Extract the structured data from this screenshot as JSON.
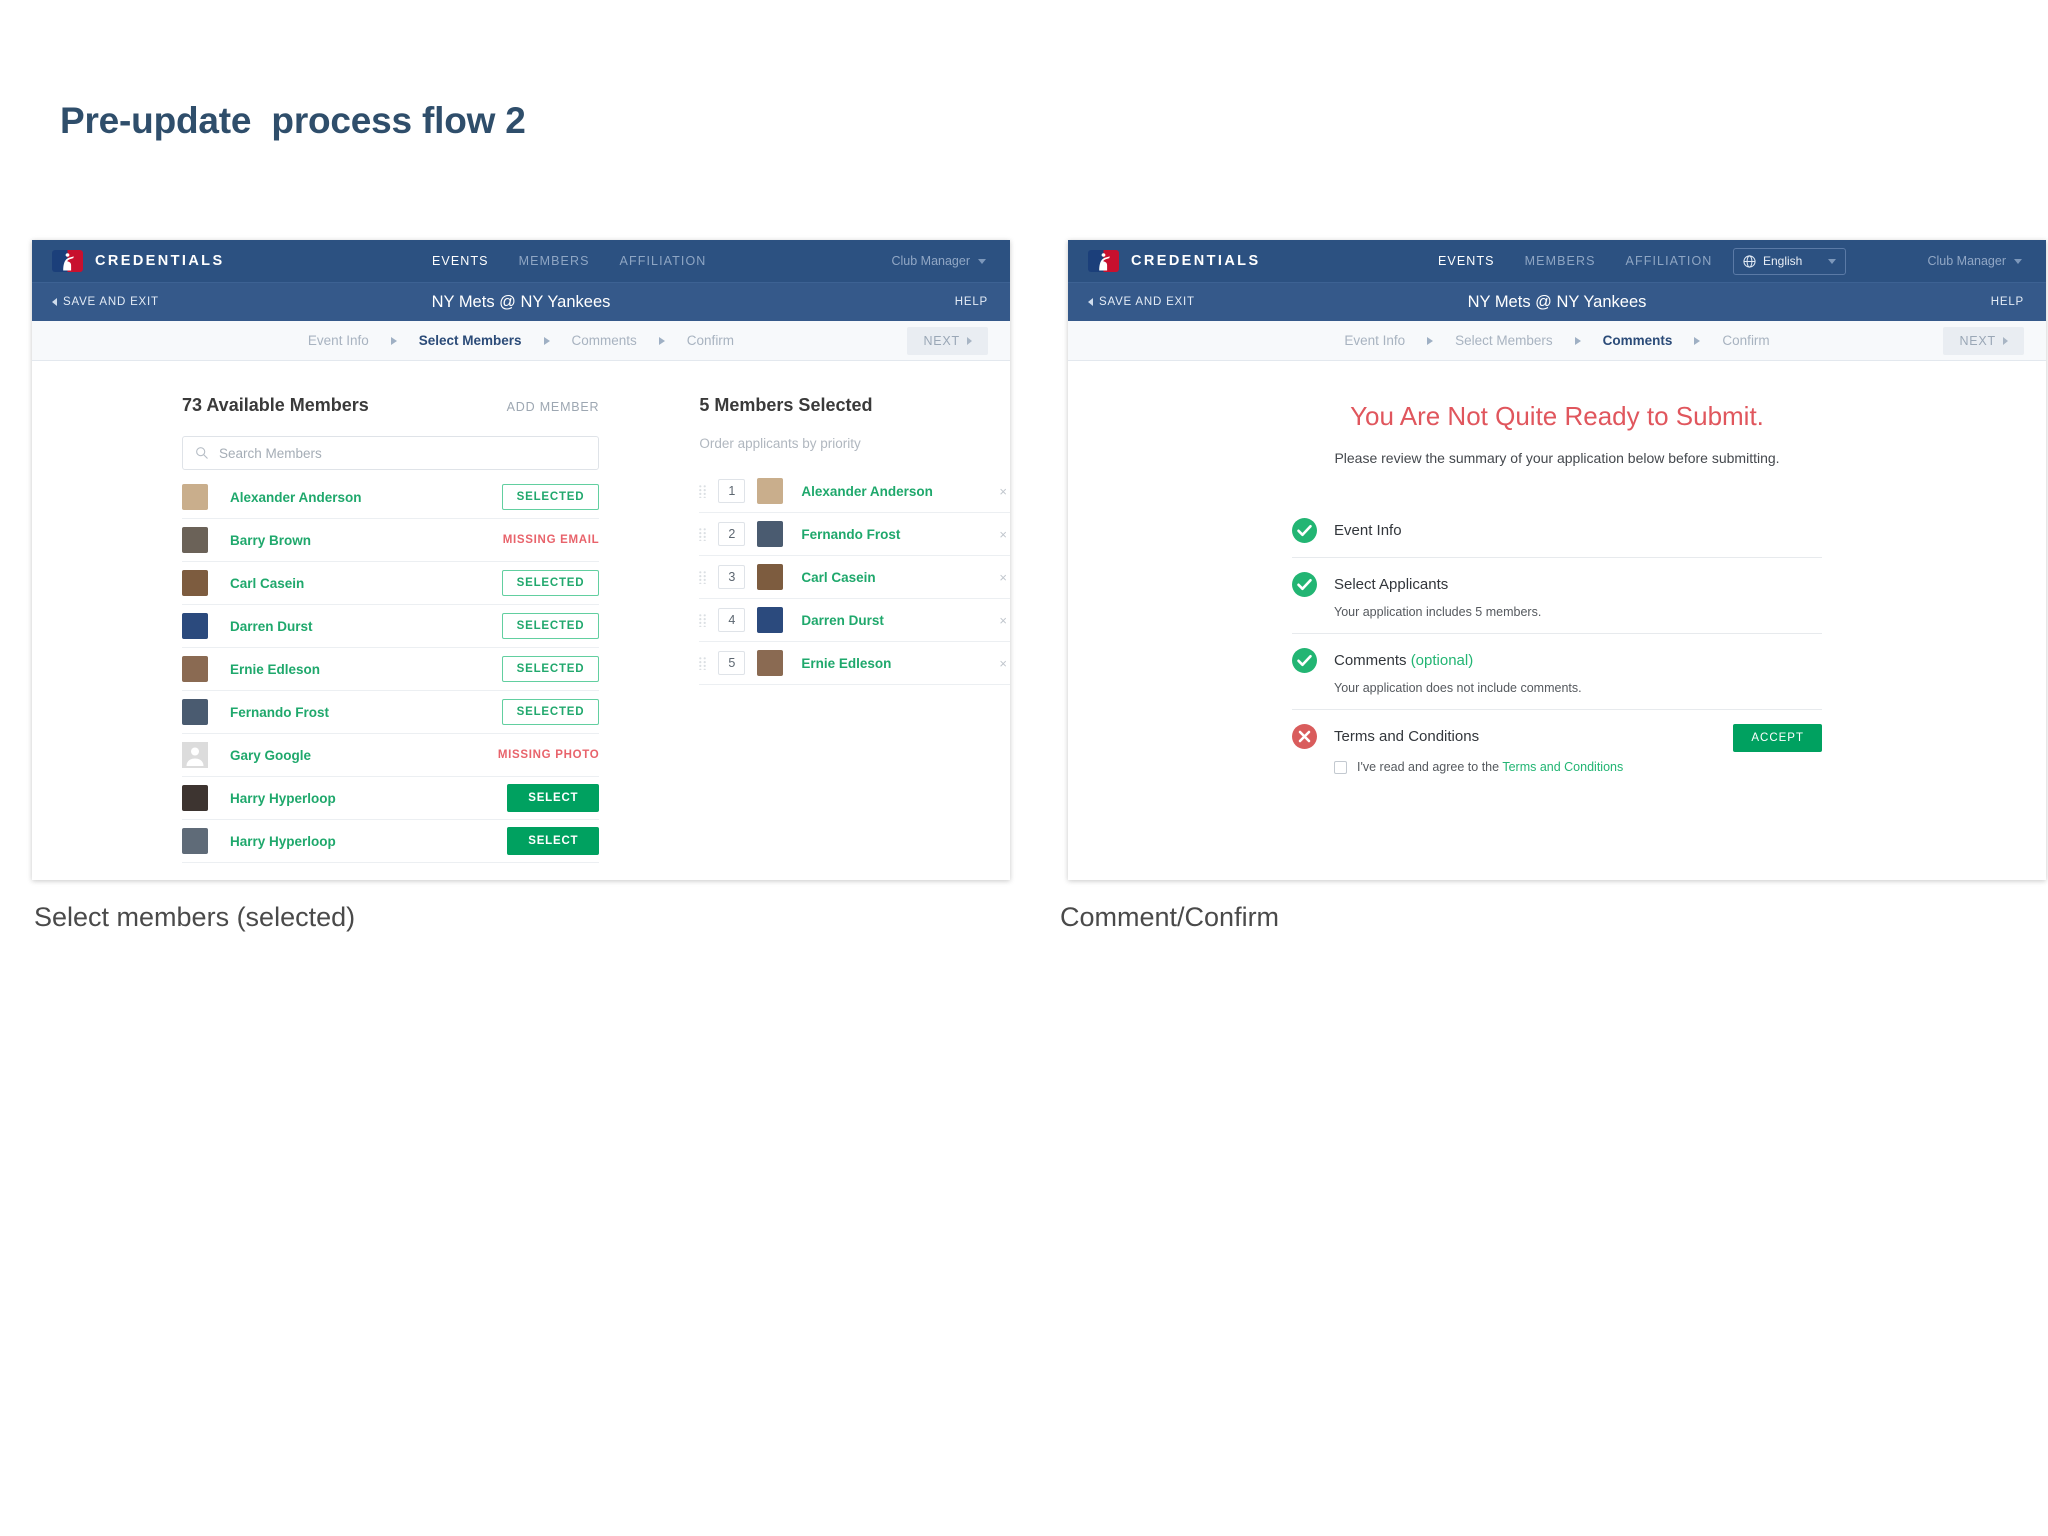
{
  "page": {
    "title": "Pre-update  process flow 2"
  },
  "brand": {
    "name": "CREDENTIALS",
    "logo_icon": "mlb-logo-icon"
  },
  "panels": {
    "left": {
      "caption": "Select members (selected)",
      "topnav": [
        {
          "label": "EVENTS",
          "active": true
        },
        {
          "label": "MEMBERS",
          "active": false
        },
        {
          "label": "AFFILIATION",
          "active": false
        }
      ],
      "user_menu": {
        "label": "Club Manager",
        "icon": "chevron-down-icon"
      },
      "subheader": {
        "save_and_exit": "SAVE AND EXIT",
        "event_title": "NY Mets @ NY Yankees",
        "help": "HELP"
      },
      "steps": [
        {
          "label": "Event Info",
          "active": false
        },
        {
          "label": "Select Members",
          "active": true
        },
        {
          "label": "Comments",
          "active": false
        },
        {
          "label": "Confirm",
          "active": false
        }
      ],
      "next_button": "NEXT",
      "available": {
        "heading": "73 Available Members",
        "add_member": "ADD MEMBER",
        "search_placeholder": "Search Members",
        "search_value": "",
        "rows": [
          {
            "name": "Alexander Anderson",
            "action": "SELECTED",
            "action_type": "selected",
            "avatar": "#c9ae8c"
          },
          {
            "name": "Barry Brown",
            "action": "MISSING EMAIL",
            "action_type": "status",
            "avatar": "#6b6258"
          },
          {
            "name": "Carl Casein",
            "action": "SELECTED",
            "action_type": "selected",
            "avatar": "#7d5c3f"
          },
          {
            "name": "Darren Durst",
            "action": "SELECTED",
            "action_type": "selected",
            "avatar": "#2b4a7d"
          },
          {
            "name": "Ernie Edleson",
            "action": "SELECTED",
            "action_type": "selected",
            "avatar": "#8a6a52"
          },
          {
            "name": "Fernando Frost",
            "action": "SELECTED",
            "action_type": "selected",
            "avatar": "#4a5b70"
          },
          {
            "name": "Gary Google",
            "action": "MISSING PHOTO",
            "action_type": "status",
            "avatar": "#d8d8d8"
          },
          {
            "name": "Harry Hyperloop",
            "action": "SELECT",
            "action_type": "select",
            "avatar": "#3d3430"
          },
          {
            "name": "Harry Hyperloop",
            "action": "SELECT",
            "action_type": "select",
            "avatar": "#5f6b78"
          }
        ]
      },
      "selected": {
        "heading": "5 Members Selected",
        "order_hint": "Order applicants by priority",
        "rows": [
          {
            "rank": "1",
            "name": "Alexander Anderson",
            "avatar": "#c9ae8c",
            "remove": "×"
          },
          {
            "rank": "2",
            "name": "Fernando Frost",
            "avatar": "#4a5b70",
            "remove": "×"
          },
          {
            "rank": "3",
            "name": "Carl Casein",
            "avatar": "#7d5c3f",
            "remove": "×"
          },
          {
            "rank": "4",
            "name": "Darren Durst",
            "avatar": "#2b4a7d",
            "remove": "×"
          },
          {
            "rank": "5",
            "name": "Ernie Edleson",
            "avatar": "#8a6a52",
            "remove": "×"
          }
        ]
      }
    },
    "right": {
      "caption": "Comment/Confirm",
      "topnav": [
        {
          "label": "EVENTS",
          "active": true
        },
        {
          "label": "MEMBERS",
          "active": false
        },
        {
          "label": "AFFILIATION",
          "active": false
        }
      ],
      "language": {
        "label": "English",
        "icon": "globe-icon"
      },
      "user_menu": {
        "label": "Club Manager",
        "icon": "chevron-down-icon"
      },
      "subheader": {
        "save_and_exit": "SAVE AND EXIT",
        "event_title": "NY Mets @ NY Yankees",
        "help": "HELP"
      },
      "steps": [
        {
          "label": "Event Info",
          "active": false
        },
        {
          "label": "Select Members",
          "active": false
        },
        {
          "label": "Comments",
          "active": true
        },
        {
          "label": "Confirm",
          "active": false
        }
      ],
      "next_button": "NEXT",
      "summary": {
        "title": "You Are Not Quite Ready to Submit.",
        "subtitle": "Please review the summary of your application below before submitting.",
        "items": [
          {
            "label": "Event Info",
            "label_suffix": "",
            "status": "ok",
            "desc": ""
          },
          {
            "label": "Select Applicants",
            "label_suffix": "",
            "status": "ok",
            "desc": "Your application includes 5 members."
          },
          {
            "label": "Comments ",
            "label_suffix": "(optional)",
            "status": "ok",
            "desc": "Your application does not include comments."
          },
          {
            "label": "Terms and Conditions",
            "label_suffix": "",
            "status": "error",
            "desc": ""
          }
        ],
        "accept_button": "ACCEPT",
        "agree_prefix": "I've read and agree to the ",
        "agree_link": "Terms and Conditions",
        "agree_checked": false
      }
    }
  },
  "colors": {
    "brand_navy": "#2c5181",
    "sub_navy": "#35598a",
    "green": "#00a160",
    "green_light": "#22b573",
    "red": "#d95c5c",
    "red_text": "#e0565d",
    "status_red": "#e8636b"
  }
}
